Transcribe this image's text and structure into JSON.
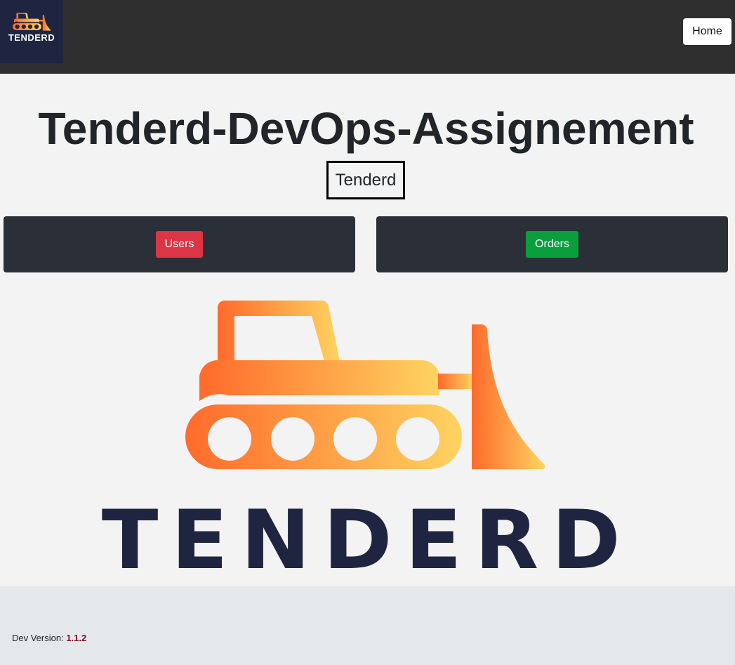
{
  "navbar": {
    "logo_text": "TENDERD",
    "home_label": "Home"
  },
  "main": {
    "title": "Tenderd-DevOps-Assignement",
    "subtitle": "Tenderd",
    "users_label": "Users",
    "orders_label": "Orders",
    "hero_text": "TENDERD"
  },
  "footer": {
    "version_label": "Dev Version:",
    "version_number": "1.1.2"
  },
  "colors": {
    "navbar": "#2f2f2f",
    "logo_bg": "#1f2540",
    "users_button": "#dc3545",
    "orders_button": "#0a9e3d",
    "card": "#2b3038",
    "gradient_start": "#ff6a2b",
    "gradient_end": "#ffd461",
    "brand_navy": "#1f2540"
  },
  "icons": {
    "nav_logo": "bulldozer-icon",
    "hero_logo": "bulldozer-icon"
  }
}
